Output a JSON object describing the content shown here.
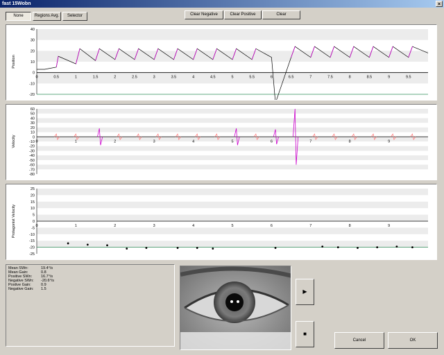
{
  "window": {
    "title": "fast 15Wobn",
    "close_label": "×"
  },
  "toolbar": {
    "mode_buttons": [
      "None",
      "Regions Avg.",
      "Selector"
    ],
    "clear_negative": "Clear Negative",
    "clear_positive": "Clear Positive",
    "clear": "Clear"
  },
  "stats": [
    {
      "label": "Mean SWn:",
      "value": "19.4°/s"
    },
    {
      "label": "Mean Gain:",
      "value": "0.8"
    },
    {
      "label": "Positive SWn:",
      "value": "16.7°/s"
    },
    {
      "label": "Negative SWn:",
      "value": "-20.6°/s"
    },
    {
      "label": "Postive Gain:",
      "value": "0.9"
    },
    {
      "label": "Negative Gain:",
      "value": "1.5"
    }
  ],
  "controls": {
    "play_icon": "▶",
    "stop_icon": "■",
    "cancel": "Cancel",
    "ok": "OK"
  },
  "colors": {
    "trace": "#000000",
    "highlight": "#cc00cc",
    "reference": "#2e8b57",
    "accent_pink": "#ff8080"
  },
  "icons": [
    "close-icon",
    "play-icon",
    "stop-icon",
    "eye-image"
  ],
  "chart_data": [
    {
      "type": "line",
      "ylabel": "Position",
      "ylim": [
        -20,
        40
      ],
      "yticks": [
        "40",
        "30",
        "20",
        "10",
        "0",
        "-10",
        "-20"
      ],
      "xticks": [
        "0",
        "0.5",
        "1",
        "1.5",
        "2",
        "2.5",
        "3",
        "3.5",
        "4",
        "4.5",
        "5",
        "5.5",
        "6",
        "6.5",
        "7",
        "7.5",
        "8",
        "8.5",
        "9",
        "9.5"
      ],
      "xlim": [
        0,
        10
      ],
      "reference_line": -20,
      "series": [
        {
          "values_x": [
            0,
            0.2,
            0.5,
            0.55,
            1.0,
            1.1,
            1.5,
            1.6,
            2.0,
            2.1,
            2.5,
            2.6,
            3.0,
            3.1,
            3.5,
            3.6,
            4.0,
            4.1,
            4.5,
            4.6,
            5.0,
            5.1,
            5.5,
            5.6,
            6.0,
            6.1,
            6.5,
            6.6,
            7.0,
            7.1,
            7.5,
            7.6,
            8.0,
            8.1,
            8.5,
            8.6,
            9.0,
            9.1,
            9.5,
            9.6,
            10
          ],
          "values_y": [
            3,
            3,
            5,
            15,
            8,
            22,
            11,
            22,
            12,
            22,
            12,
            22,
            12,
            22,
            12,
            22,
            12,
            22,
            12,
            22,
            12,
            22,
            12,
            22,
            14,
            -30,
            14,
            24,
            14,
            24,
            14,
            24,
            14,
            24,
            14,
            24,
            14,
            24,
            14,
            24,
            18
          ]
        }
      ]
    },
    {
      "type": "line",
      "ylabel": "Velocity",
      "ylim": [
        -80,
        60
      ],
      "yticks": [
        "60",
        "50",
        "40",
        "30",
        "20",
        "10",
        "0",
        "-10",
        "-20",
        "-30",
        "-40",
        "-50",
        "-60",
        "-70",
        "-80"
      ],
      "xticks": [
        "0",
        "1",
        "2",
        "3",
        "4",
        "5",
        "6",
        "7",
        "8",
        "9"
      ],
      "xlim": [
        0,
        10
      ],
      "spikes_x": [
        0.5,
        1.0,
        1.6,
        2.1,
        2.6,
        3.1,
        3.6,
        4.1,
        4.6,
        5.1,
        5.6,
        6.1,
        6.6,
        7.1,
        7.6,
        8.1,
        8.6,
        9.1,
        9.6
      ],
      "spikes_y": [
        6,
        6,
        18,
        6,
        6,
        6,
        6,
        6,
        6,
        18,
        6,
        16,
        60,
        6,
        6,
        6,
        6,
        6,
        6
      ]
    },
    {
      "type": "scatter",
      "ylabel": "Protagonist Velocity",
      "ylim": [
        -25,
        25
      ],
      "yticks": [
        "25",
        "20",
        "15",
        "10",
        "5",
        "0",
        "-5",
        "-10",
        "-15",
        "-20",
        "-25"
      ],
      "xticks": [
        "0",
        "1",
        "2",
        "3",
        "4",
        "5",
        "6",
        "7",
        "8",
        "9"
      ],
      "xlim": [
        0,
        10
      ],
      "reference_line": -20,
      "x": [
        0.8,
        1.3,
        1.8,
        2.3,
        2.8,
        3.6,
        4.1,
        4.5,
        6.1,
        7.3,
        7.7,
        8.2,
        8.7,
        9.2,
        9.6
      ],
      "y": [
        -17,
        -18,
        -18.5,
        -21,
        -20.5,
        -20.5,
        -20.5,
        -21,
        -20.5,
        -19.5,
        -20,
        -20.5,
        -20,
        -19.5,
        -20
      ]
    }
  ]
}
